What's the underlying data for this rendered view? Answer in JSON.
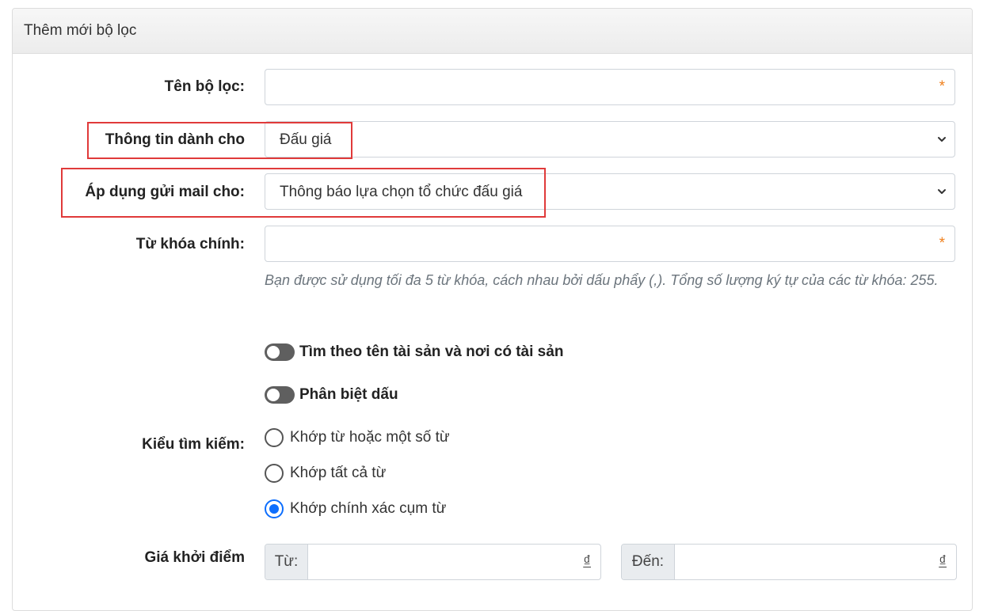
{
  "panel": {
    "title": "Thêm mới bộ lọc"
  },
  "fields": {
    "filter_name": {
      "label": "Tên bộ lọc:",
      "value": "",
      "required_mark": "*"
    },
    "info_for": {
      "label": "Thông tin dành cho",
      "selected": "Đấu giá"
    },
    "apply_mail": {
      "label": "Áp dụng gửi mail cho:",
      "selected": "Thông báo lựa chọn tổ chức đấu giá"
    },
    "keywords": {
      "label": "Từ khóa chính:",
      "value": "",
      "required_mark": "*",
      "hint": "Bạn được sử dụng tối đa 5 từ khóa, cách nhau bởi dấu phẩy (,). Tổng số lượng ký tự của các từ khóa: 255."
    }
  },
  "toggles": [
    {
      "label": "Tìm theo tên tài sản và nơi có tài sản",
      "on": false
    },
    {
      "label": "Phân biệt dấu",
      "on": false
    }
  ],
  "search_type": {
    "label": "Kiểu tìm kiếm:",
    "options": [
      {
        "label": "Khớp từ hoặc một số từ",
        "checked": false
      },
      {
        "label": "Khớp tất cả từ",
        "checked": false
      },
      {
        "label": "Khớp chính xác cụm từ",
        "checked": true
      }
    ]
  },
  "starting_price": {
    "label": "Giá khởi điểm",
    "from": {
      "prefix": "Từ:",
      "value": "",
      "suffix": "₫"
    },
    "to": {
      "prefix": "Đến:",
      "value": "",
      "suffix": "₫"
    }
  },
  "colors": {
    "accent": "#0d6efd",
    "required": "#f07f1b",
    "highlight": "#e03a3a",
    "toggle_off": "#5f5f5f"
  },
  "icons": {
    "select_arrow": "chevron-down-icon"
  }
}
